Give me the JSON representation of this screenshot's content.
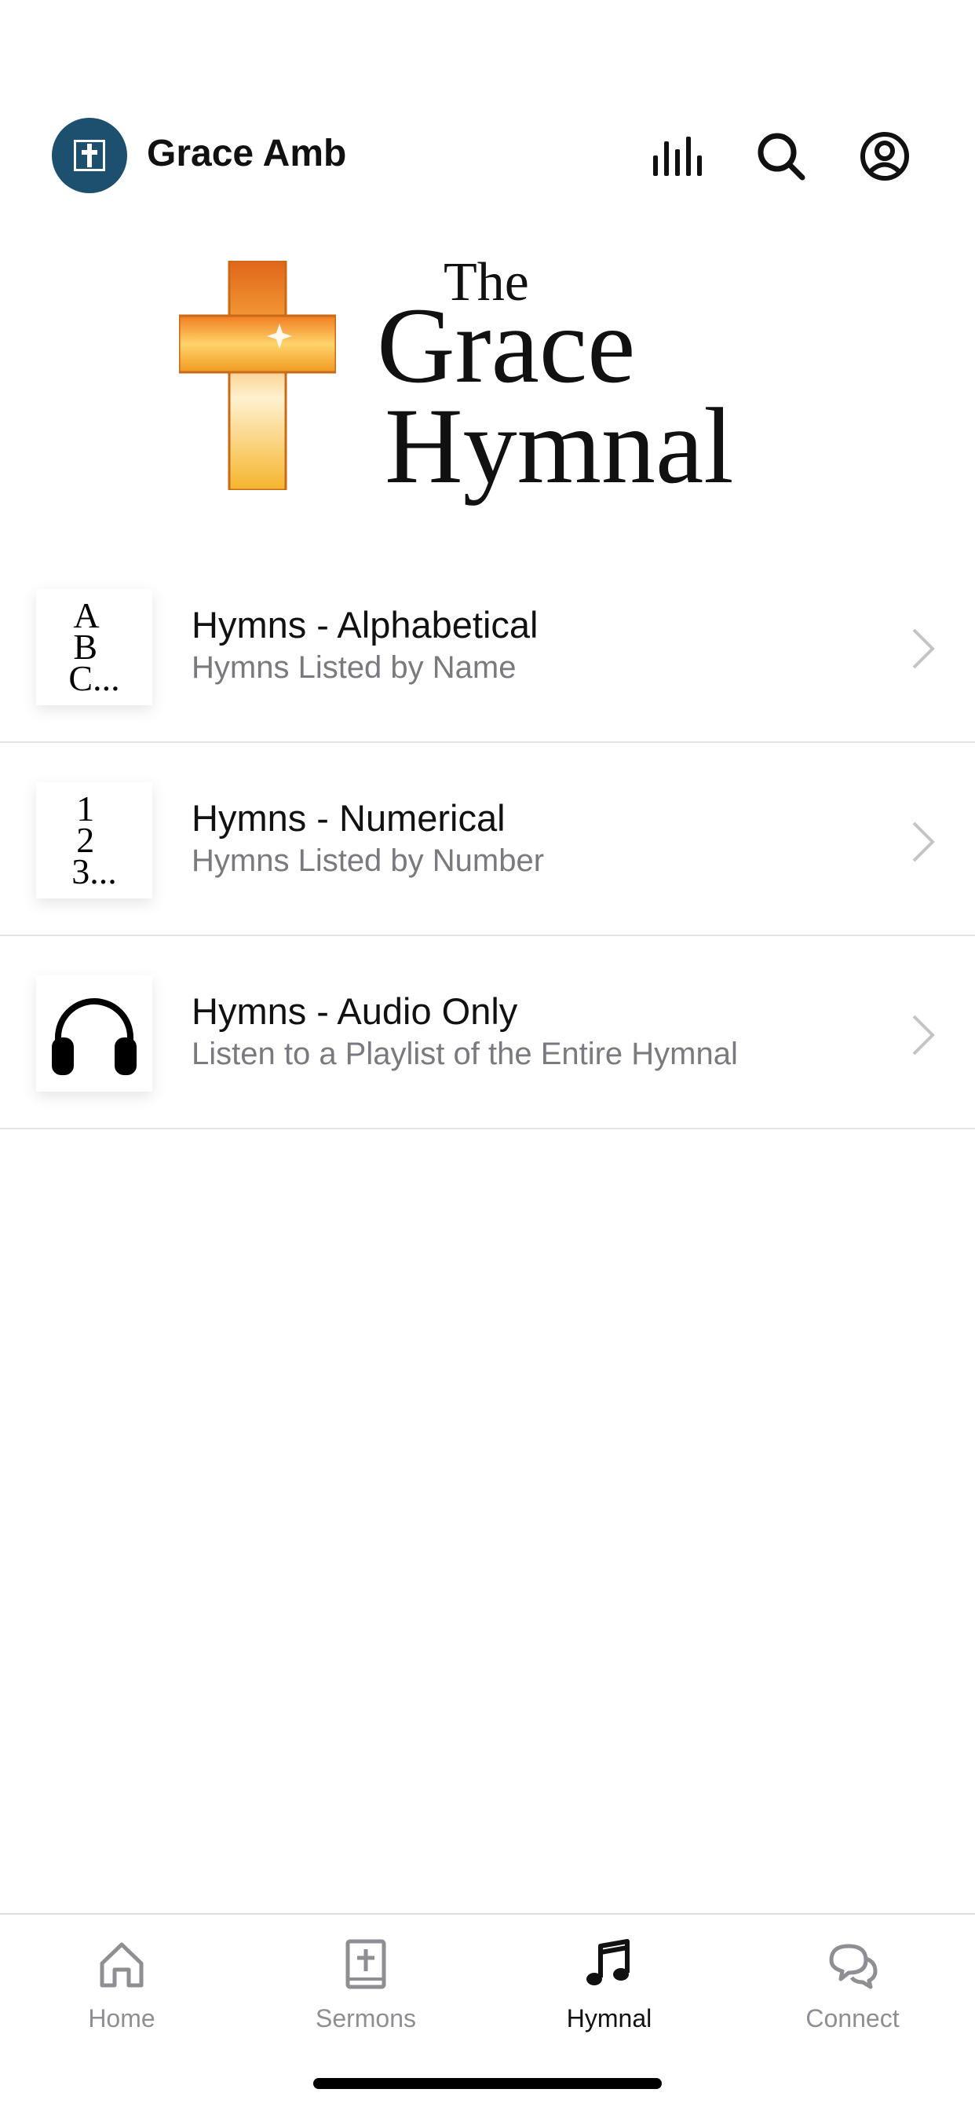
{
  "header": {
    "title": "Grace Amb",
    "logo_icon": "cross-icon",
    "actions": [
      "audio-bars-icon",
      "search-icon",
      "account-icon"
    ]
  },
  "hero": {
    "line1": "The",
    "line2": "Grace",
    "line3": "Hymnal",
    "icon": "cross-icon"
  },
  "list": [
    {
      "title": "Hymns - Alphabetical",
      "subtitle": "Hymns Listed by Name",
      "thumb_lines": [
        "A",
        "B",
        "C..."
      ]
    },
    {
      "title": "Hymns - Numerical",
      "subtitle": "Hymns Listed by Number",
      "thumb_lines": [
        "1",
        "2",
        "3..."
      ]
    },
    {
      "title": "Hymns - Audio Only",
      "subtitle": "Listen to a Playlist of the Entire Hymnal",
      "thumb_icon": "headphones-icon"
    }
  ],
  "tabbar": {
    "tabs": [
      {
        "label": "Home",
        "icon": "home-icon"
      },
      {
        "label": "Sermons",
        "icon": "bible-icon"
      },
      {
        "label": "Hymnal",
        "icon": "music-note-icon",
        "active": true
      },
      {
        "label": "Connect",
        "icon": "chat-bubbles-icon"
      }
    ]
  },
  "colors": {
    "brand": "#1d4f6e",
    "active_tab": "#111111",
    "inactive_tab": "#8e8e93",
    "subtitle": "#7a7a7e"
  }
}
